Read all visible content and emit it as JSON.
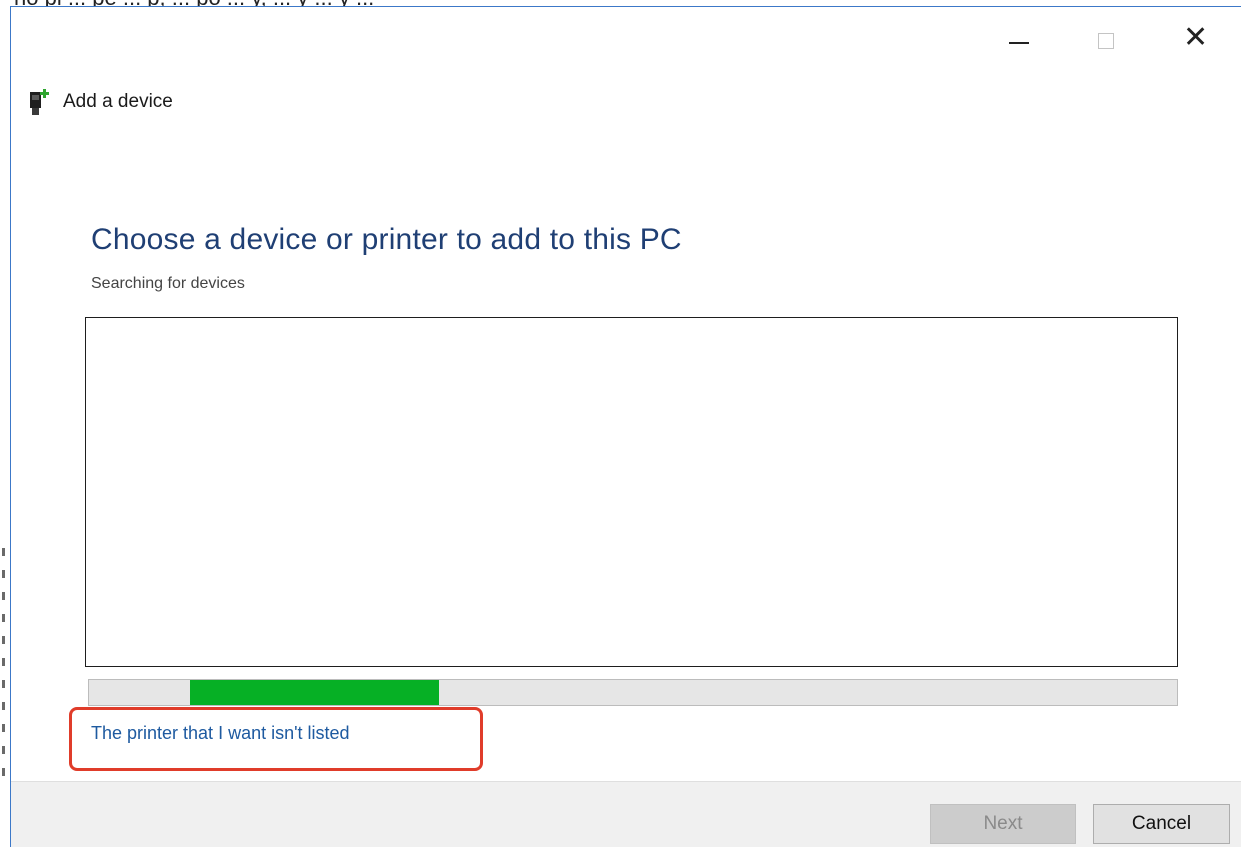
{
  "background": {
    "caption_fragment": "ho pi ... pe ... p, ... po ... y, ... y ... y ..."
  },
  "window": {
    "title": "Add a device",
    "icon": "device-add-icon",
    "controls": {
      "minimize_icon": "minimize-icon",
      "maximize_icon": "maximize-icon",
      "close_icon": "close-icon",
      "close_glyph": "✕"
    }
  },
  "content": {
    "heading": "Choose a device or printer to add to this PC",
    "status": "Searching for devices",
    "device_list": [],
    "progress": {
      "style": "marquee",
      "chunk_start": 0.093,
      "chunk_end": 0.322,
      "color": "#06b025"
    },
    "printer_link": "The printer that I want isn't listed",
    "highlight_color": "#e03c2a"
  },
  "footer": {
    "next_label": "Next",
    "next_enabled": false,
    "cancel_label": "Cancel"
  },
  "colors": {
    "heading": "#1f3f74",
    "link": "#1e5aa0",
    "window_border": "#3c78c8"
  }
}
